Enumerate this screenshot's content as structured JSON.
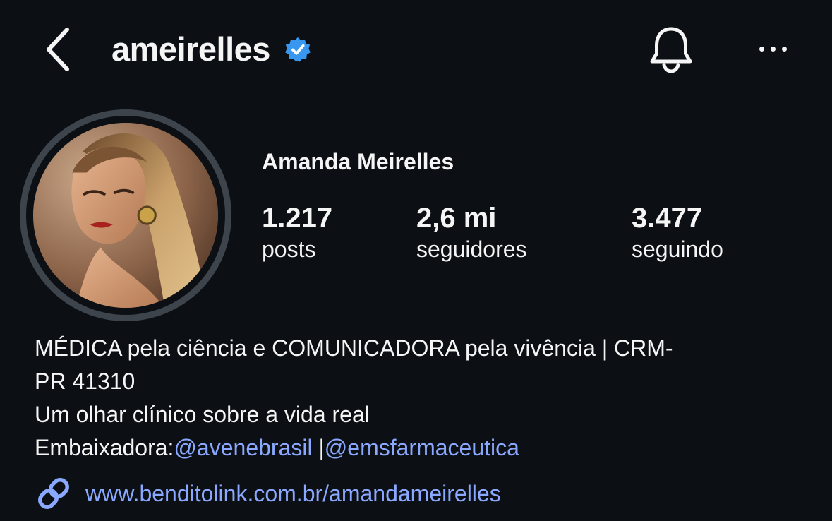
{
  "header": {
    "username": "ameirelles",
    "back_icon": "chevron-left-icon",
    "verified_icon": "verified-badge-icon",
    "bell_icon": "bell-icon",
    "more_icon": "more-horizontal-icon"
  },
  "profile": {
    "display_name": "Amanda Meirelles",
    "stats": [
      {
        "value": "1.217",
        "label": "posts"
      },
      {
        "value": "2,6 mi",
        "label": "seguidores"
      },
      {
        "value": "3.477",
        "label": "seguindo"
      }
    ]
  },
  "bio": {
    "line1": "MÉDICA pela ciência e COMUNICADORA pela vivência | CRM-",
    "line2": "PR 41310",
    "line3": "Um olhar clínico sobre a vida real",
    "line4_prefix": "Embaixadora:",
    "mention1": "@avenebrasil",
    "separator": " |",
    "mention2": "@emsfarmaceutica",
    "link_icon": "link-icon",
    "link": "www.benditolink.com.br/amandameirelles"
  },
  "colors": {
    "background": "#0c1014",
    "text": "#f5f5f5",
    "link": "#8aa8ff",
    "verified": "#3897f0",
    "avatar_ring": "#3d444c"
  }
}
